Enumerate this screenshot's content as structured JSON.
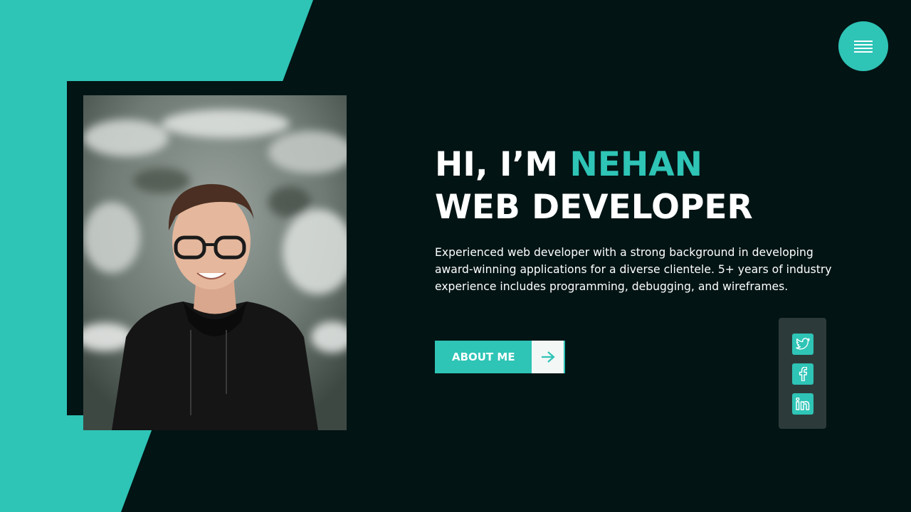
{
  "hero": {
    "greeting": "HI, I’M ",
    "name": "NEHAN",
    "role": "WEB DEVELOPER",
    "bio": "Experienced web developer with a strong background in developing award-winning applications for a diverse clientele. 5+ years of industry experience includes programming, debugging, and wireframes.",
    "cta_label": "ABOUT ME"
  },
  "icons": {
    "menu": "hamburger-menu-icon",
    "cta_arrow": "arrow-right-icon",
    "profile": "profile-photo"
  },
  "social": [
    {
      "network": "Twitter",
      "icon": "twitter-icon"
    },
    {
      "network": "Facebook",
      "icon": "facebook-icon"
    },
    {
      "network": "LinkedIn",
      "icon": "linkedin-icon"
    }
  ],
  "colors": {
    "background": "#031414",
    "accent": "#2ec4b6",
    "text": "#ffffff",
    "social_panel": "#2c3b3a"
  }
}
